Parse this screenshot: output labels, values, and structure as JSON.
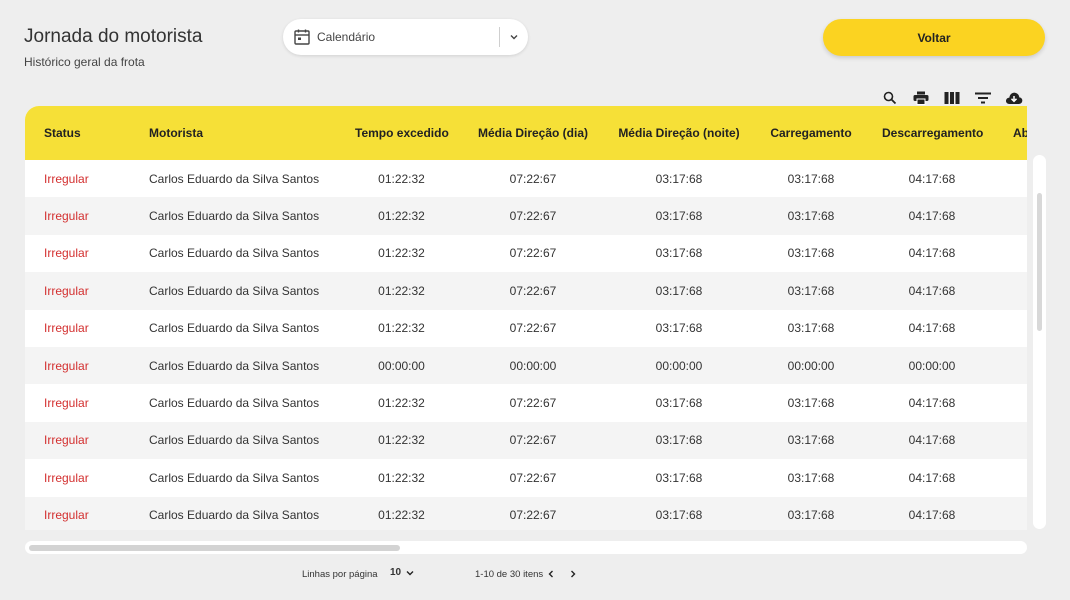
{
  "header": {
    "title": "Jornada do motorista",
    "subtitle": "Histórico geral da frota"
  },
  "calendar": {
    "icon": "calendar-icon",
    "label": "Calendário"
  },
  "back_button": {
    "label": "Voltar"
  },
  "toolbar": {
    "icons": [
      "search-icon",
      "print-icon",
      "columns-icon",
      "filter-icon",
      "cloud-download-icon"
    ]
  },
  "colors": {
    "accent": "#fbd321",
    "header_bg": "#f6e037",
    "status_irregular": "#d32f2f"
  },
  "table": {
    "columns": [
      "Status",
      "Motorista",
      "Tempo excedido",
      "Média Direção (dia)",
      "Média Direção (noite)",
      "Carregamento",
      "Descarregamento",
      "Ab"
    ],
    "rows": [
      [
        "Irregular",
        "Carlos Eduardo da Silva Santos",
        "01:22:32",
        "07:22:67",
        "03:17:68",
        "03:17:68",
        "04:17:68"
      ],
      [
        "Irregular",
        "Carlos Eduardo da Silva Santos",
        "01:22:32",
        "07:22:67",
        "03:17:68",
        "03:17:68",
        "04:17:68"
      ],
      [
        "Irregular",
        "Carlos Eduardo da Silva Santos",
        "01:22:32",
        "07:22:67",
        "03:17:68",
        "03:17:68",
        "04:17:68"
      ],
      [
        "Irregular",
        "Carlos Eduardo da Silva Santos",
        "01:22:32",
        "07:22:67",
        "03:17:68",
        "03:17:68",
        "04:17:68"
      ],
      [
        "Irregular",
        "Carlos Eduardo da Silva Santos",
        "01:22:32",
        "07:22:67",
        "03:17:68",
        "03:17:68",
        "04:17:68"
      ],
      [
        "Irregular",
        "Carlos Eduardo da Silva Santos",
        "00:00:00",
        "00:00:00",
        "00:00:00",
        "00:00:00",
        "00:00:00"
      ],
      [
        "Irregular",
        "Carlos Eduardo da Silva Santos",
        "01:22:32",
        "07:22:67",
        "03:17:68",
        "03:17:68",
        "04:17:68"
      ],
      [
        "Irregular",
        "Carlos Eduardo da Silva Santos",
        "01:22:32",
        "07:22:67",
        "03:17:68",
        "03:17:68",
        "04:17:68"
      ],
      [
        "Irregular",
        "Carlos Eduardo da Silva Santos",
        "01:22:32",
        "07:22:67",
        "03:17:68",
        "03:17:68",
        "04:17:68"
      ],
      [
        "Irregular",
        "Carlos Eduardo da Silva Santos",
        "01:22:32",
        "07:22:67",
        "03:17:68",
        "03:17:68",
        "04:17:68"
      ]
    ]
  },
  "pagination": {
    "rows_per_page_label": "Linhas por página",
    "rows_per_page_value": "10",
    "range_label": "1-10 de 30 itens",
    "prev_icon": "chevron-left-icon",
    "next_icon": "chevron-right-icon"
  }
}
